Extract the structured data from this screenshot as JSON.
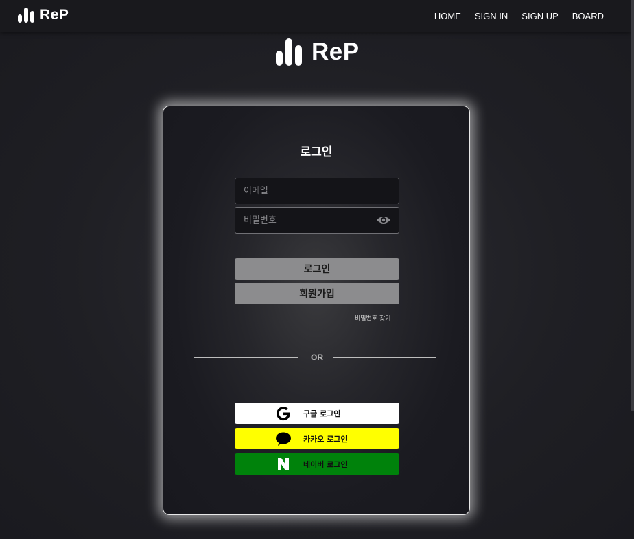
{
  "nav": {
    "brand": "ReP",
    "links": [
      "HOME",
      "SIGN IN",
      "SIGN UP",
      "BOARD"
    ]
  },
  "hero": {
    "brand": "ReP"
  },
  "login": {
    "title": "로그인",
    "email_placeholder": "이메일",
    "password_placeholder": "비밀번호",
    "login_button": "로그인",
    "signup_button": "회원가입",
    "find_password": "비밀번호 찾기",
    "divider": "OR",
    "social": {
      "google": "구글 로그인",
      "kakao": "카카오 로그인",
      "naver": "네이버 로그인"
    }
  },
  "colors": {
    "google_bg": "#ffffff",
    "kakao_bg": "#ffff00",
    "naver_bg": "#00820b",
    "button_bg": "#8c8c8e"
  },
  "icons": [
    "logo-bars-icon",
    "eye-icon",
    "google-icon",
    "kakao-chat-icon",
    "naver-icon"
  ]
}
